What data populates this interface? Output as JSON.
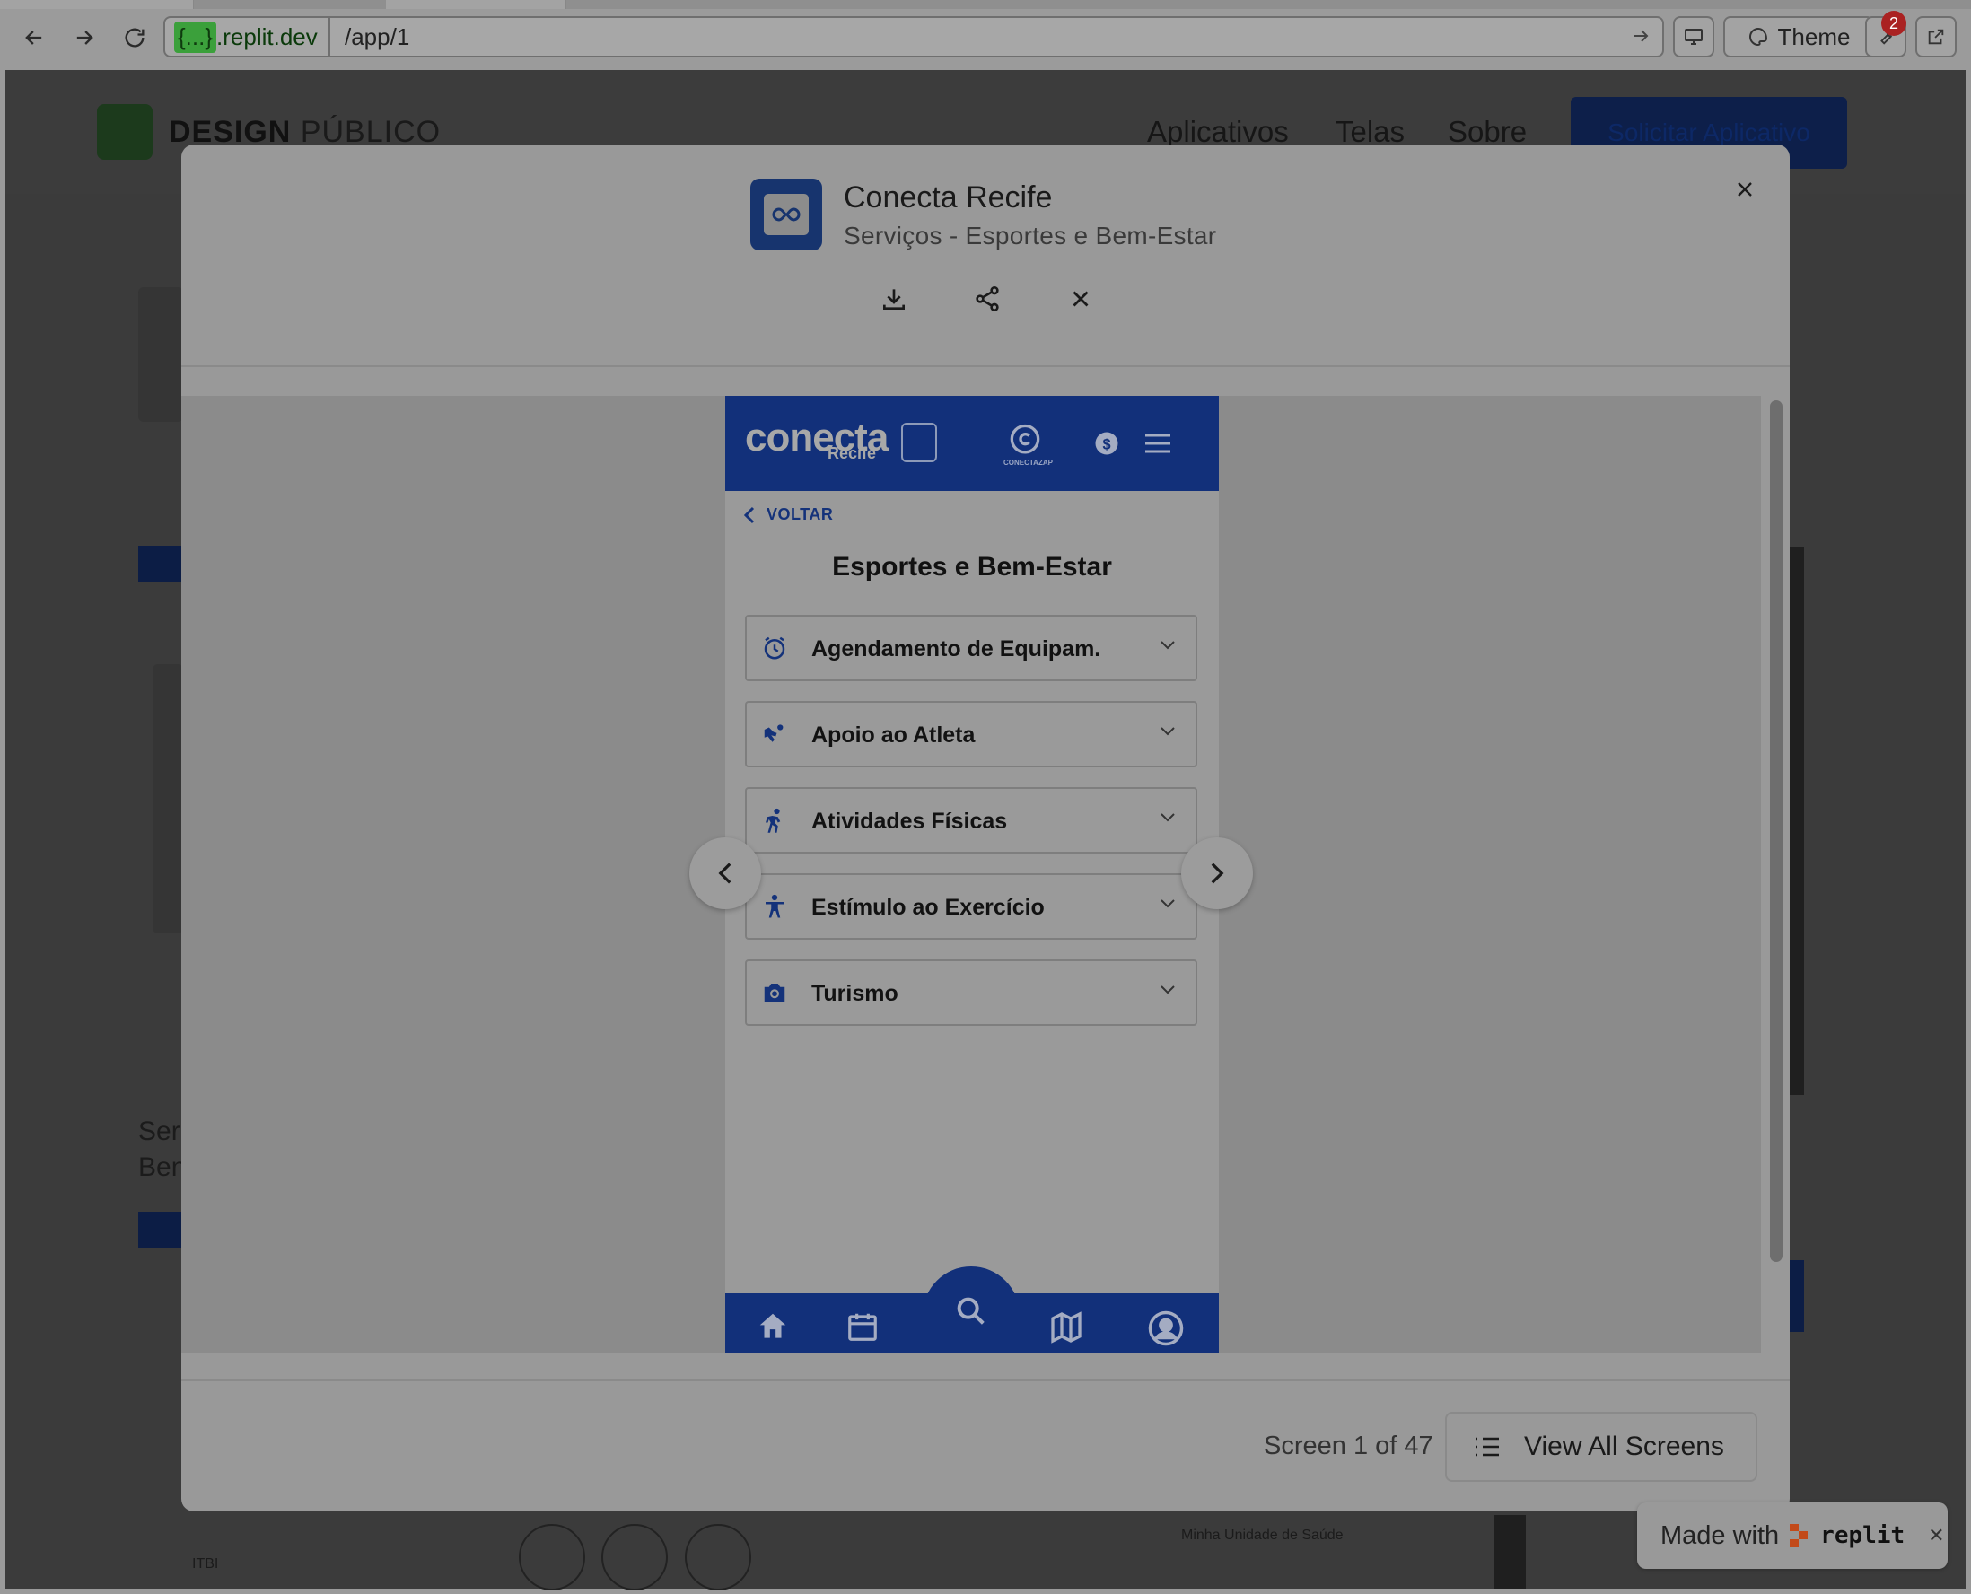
{
  "browser": {
    "url_host_chip": "{...}",
    "url_host": ".replit.dev",
    "url_path": "/app/1",
    "theme_label": "Theme",
    "notification_count": "2"
  },
  "site": {
    "brand_a": "DESIGN",
    "brand_b": "PÚBLICO",
    "nav": [
      "Aplicativos",
      "Telas",
      "Sobre"
    ],
    "cta": "Solicitar Aplicativo",
    "bg_fragments": {
      "ser": "Ser",
      "ben": "Ben",
      "itbi": "ITBI",
      "saude": "Minha Unidade de Saúde"
    }
  },
  "modal": {
    "app_title": "Conecta Recife",
    "app_subtitle": "Serviços - Esportes e Bem-Estar",
    "counter": "Screen 1 of 47",
    "view_all": "View All Screens"
  },
  "phone": {
    "brand": "conecta",
    "brand_sub": "Recife",
    "zap_label": "CONECTAZAP",
    "back_label": "VOLTAR",
    "heading": "Esportes e Bem-Estar",
    "sections": [
      {
        "label": "Agendamento de Equipam.",
        "icon": "alarm-clock-icon"
      },
      {
        "label": "Apoio ao Atleta",
        "icon": "athlete-support-icon"
      },
      {
        "label": "Atividades Físicas",
        "icon": "running-person-icon"
      },
      {
        "label": "Estímulo ao Exercício",
        "icon": "accessibility-person-icon"
      },
      {
        "label": "Turismo",
        "icon": "camera-icon"
      }
    ],
    "tabs": [
      "home-icon",
      "calendar-icon",
      "search-icon",
      "map-icon",
      "profile-icon"
    ]
  },
  "made_with": {
    "text": "Made with",
    "brand": "replit"
  }
}
